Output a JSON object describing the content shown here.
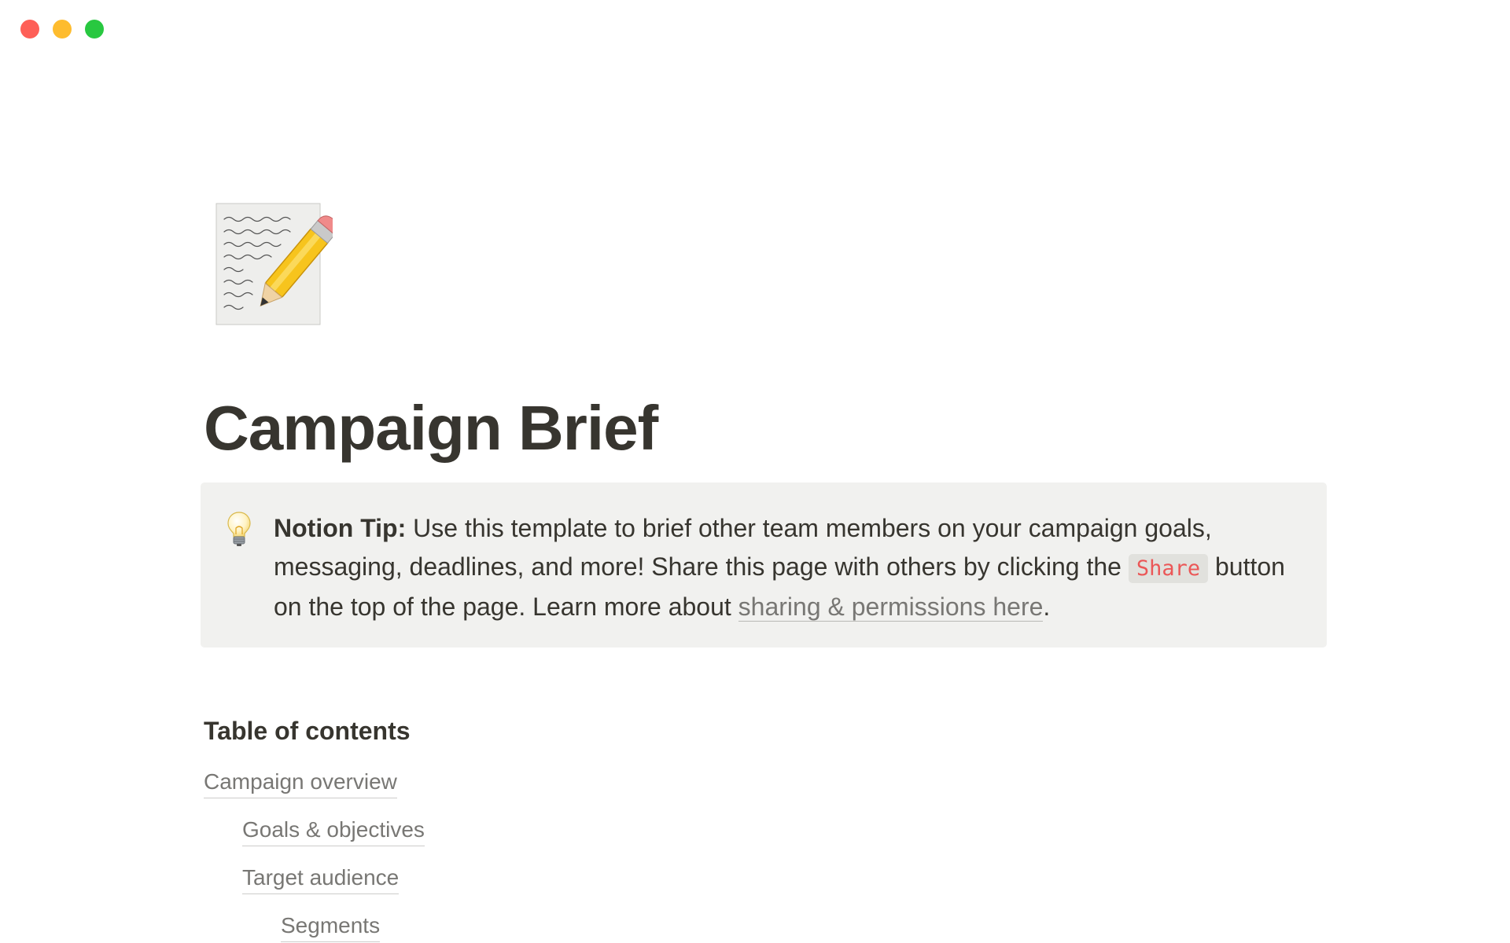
{
  "window": {
    "controls": [
      "close",
      "minimize",
      "zoom"
    ],
    "colors": {
      "close": "#fe5f57",
      "minimize": "#febc2e",
      "zoom": "#28c840"
    }
  },
  "page": {
    "icon": "memo-pencil-icon",
    "title": "Campaign Brief"
  },
  "callout": {
    "icon": "light-bulb-icon",
    "label": "Notion Tip:",
    "text_1": " Use this template to brief other team members on your campaign goals, messaging, deadlines, and more! Share this page with others by clicking the ",
    "code": "Share",
    "text_2": " button on the top of the page. Learn more about ",
    "link_text": "sharing & permissions here",
    "text_3": "."
  },
  "toc": {
    "heading": "Table of contents",
    "items": [
      {
        "label": "Campaign overview",
        "level": 1
      },
      {
        "label": "Goals & objectives",
        "level": 2
      },
      {
        "label": "Target audience",
        "level": 2
      },
      {
        "label": "Segments",
        "level": 3
      }
    ]
  }
}
